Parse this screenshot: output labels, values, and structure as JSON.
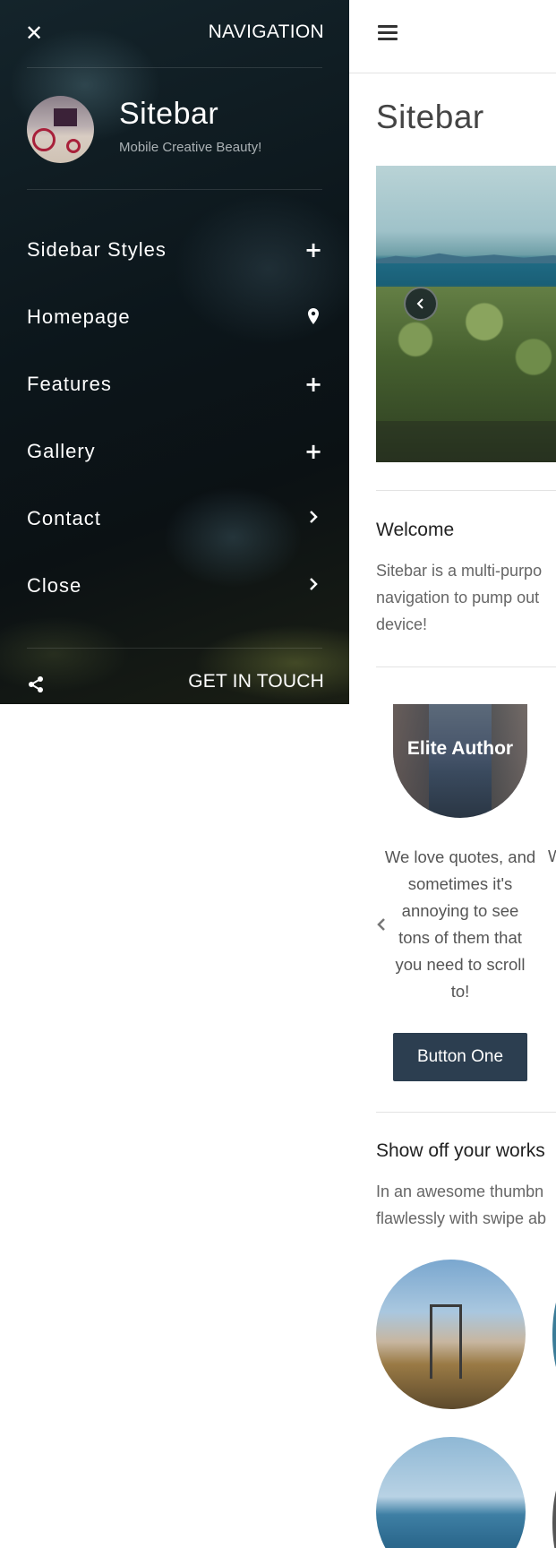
{
  "sidebar": {
    "close_icon": "close-icon",
    "heading": "NAVIGATION",
    "brand": "Sitebar",
    "tagline": "Mobile Creative Beauty!",
    "items": [
      {
        "label": "Sidebar Styles",
        "icon": "plus-icon"
      },
      {
        "label": "Homepage",
        "icon": "map-marker-icon"
      },
      {
        "label": "Features",
        "icon": "plus-icon"
      },
      {
        "label": "Gallery",
        "icon": "plus-icon"
      },
      {
        "label": "Contact",
        "icon": "chevron-right-icon"
      },
      {
        "label": "Close",
        "icon": "chevron-right-icon"
      }
    ],
    "footer": {
      "share_icon": "share-icon",
      "cta": "GET IN TOUCH"
    }
  },
  "main": {
    "menu_icon": "hamburger-icon",
    "title": "Sitebar",
    "slider": {
      "prev_icon": "chevron-left-icon"
    },
    "welcome": {
      "heading": "Welcome",
      "lines": [
        "Sitebar is a multi-purpo",
        "navigation to pump out",
        "device!"
      ]
    },
    "quote": {
      "author": "Elite Author",
      "lines": [
        "We love quotes, and",
        "sometimes it's",
        "annoying to see",
        "tons of them that",
        "you need to scroll",
        "to!"
      ],
      "peek": "W",
      "prev_icon": "chevron-left-icon",
      "button": "Button One"
    },
    "works": {
      "heading": "Show off your works",
      "lines": [
        "In an awesome thumbn",
        "flawlessly with swipe ab"
      ]
    }
  },
  "colors": {
    "sidebar_bg": "#0c161b",
    "button_bg": "#2c3e50",
    "text_muted": "#666666"
  }
}
